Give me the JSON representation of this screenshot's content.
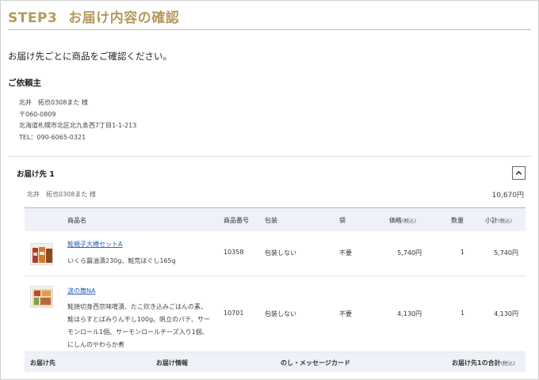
{
  "step": {
    "num": "STEP3",
    "title": "お届け内容の確認"
  },
  "lead": "お届け先ごとに商品をご確認ください。",
  "requester": {
    "heading": "ご依頼主",
    "name": "北井　拓也0308また 様",
    "postal": "〒060-0809",
    "address": "北海道札幌市北区北九条西7丁目1-1-213",
    "tel": "TEL：090-6065-0321"
  },
  "destination": {
    "heading": "お届け先 1",
    "name": "北井　拓也0308また 様",
    "subtotal": "10,670円",
    "columns": {
      "product": "商品名",
      "code": "商品番号",
      "wrap": "包装",
      "bag": "袋",
      "price": "価格",
      "price_note": "(税込)",
      "qty": "数量",
      "subtotal": "小計",
      "subtotal_note": "(税込)"
    },
    "items": [
      {
        "name": "鮭親子大樽セットA",
        "desc": "いくら醤油漬230g、鮭荒ほぐし165g",
        "code": "10358",
        "wrap": "包装しない",
        "bag": "不要",
        "price": "5,740円",
        "qty": "1",
        "subtotal": "5,740円"
      },
      {
        "name": "涙の舞NA",
        "desc": "鮭焼切身西京味噌漬、たこ炊き込みごはんの素、鮭はらすとばみりん干し100g、帆立のパテ、サーモンロール1個、サーモンロールチーズ入り1個、にしんのやわらか煮",
        "code": "10701",
        "wrap": "包装しない",
        "bag": "不要",
        "price": "4,130円",
        "qty": "1",
        "subtotal": "4,130円"
      }
    ],
    "footer": {
      "dest": "お届け先",
      "info": "お届け情報",
      "noshi": "のし・メッセージカード",
      "total": "お届け先1の合計",
      "total_note": "(税込)"
    }
  },
  "colors": {
    "accent": "#b39a5c",
    "link": "#2a62b8",
    "table_head": "#eef1f7"
  }
}
